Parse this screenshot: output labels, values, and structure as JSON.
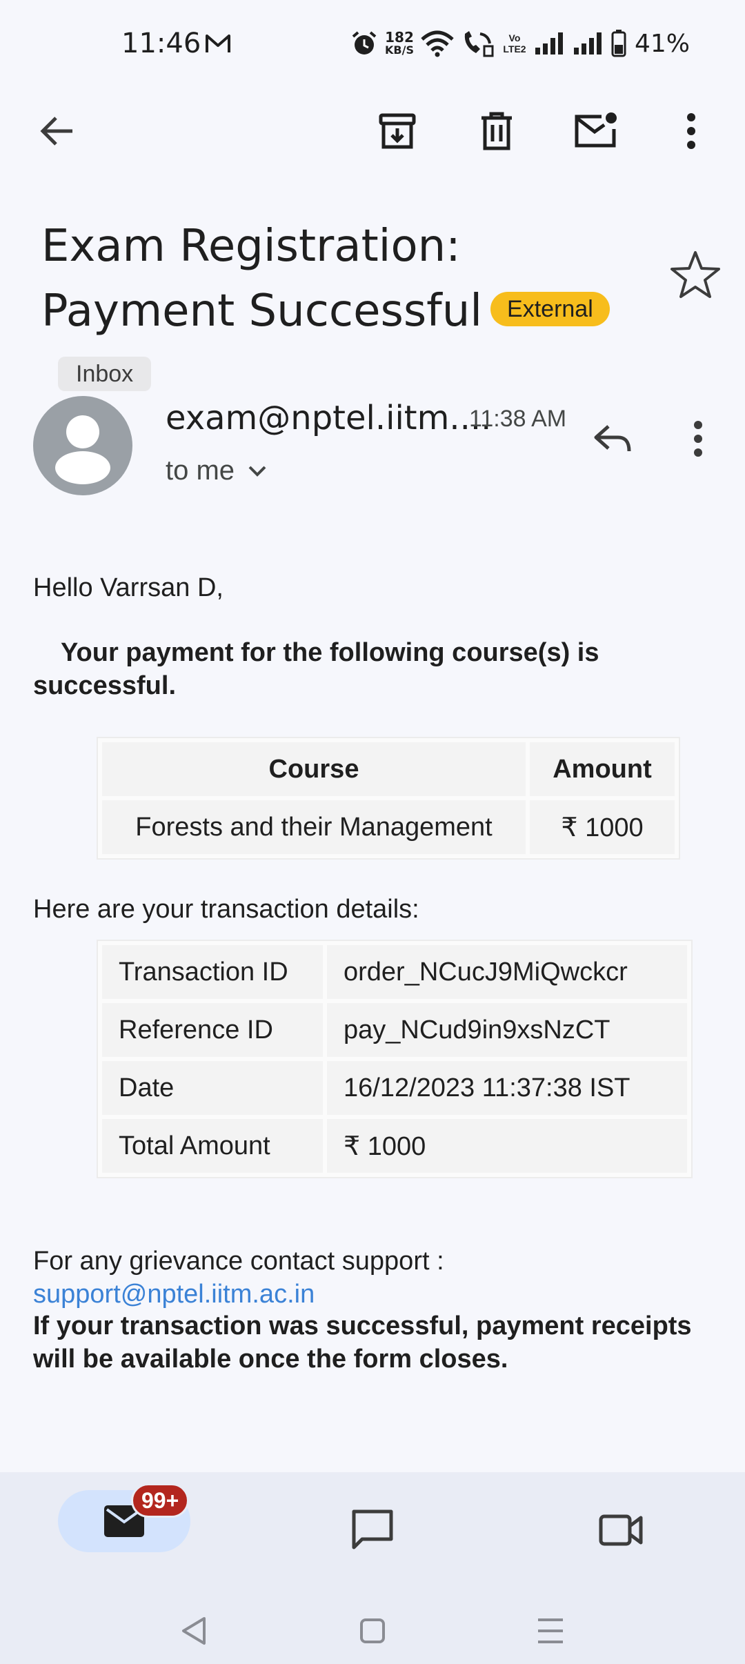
{
  "status_bar": {
    "time": "11:46",
    "speed_top": "182",
    "speed_bottom": "KB/S",
    "battery": "41%",
    "lte": "Vo LTE2"
  },
  "toolbar": {
    "back": "arrow-back-icon",
    "archive": "archive-icon",
    "delete": "delete-icon",
    "mark_unread": "mark-unread-icon",
    "more": "more-vert-icon"
  },
  "subject": {
    "text": "Exam Registration: Payment Successful",
    "label_external": "External",
    "label_inbox": "Inbox"
  },
  "sender": {
    "name": "exam@nptel.iitm....",
    "time": "11:38 AM",
    "to": "to me"
  },
  "email": {
    "greeting": "Hello Varrsan D,",
    "success_message": "Your payment for the following course(s) is successful.",
    "course_table": {
      "headers": [
        "Course",
        "Amount"
      ],
      "rows": [
        [
          "Forests and their Management",
          "₹ 1000"
        ]
      ]
    },
    "transaction_label": "Here are your transaction details:",
    "transaction_table": {
      "rows": [
        [
          "Transaction ID",
          "order_NCucJ9MiQwckcr"
        ],
        [
          "Reference ID",
          "pay_NCud9in9xsNzCT"
        ],
        [
          "Date",
          "16/12/2023 11:37:38 IST"
        ],
        [
          "Total Amount",
          "₹ 1000"
        ]
      ]
    },
    "grievance": "For any grievance contact support :",
    "support_email": "support@nptel.iitm.ac.in",
    "receipt_note": "If your transaction was successful, payment receipts will be available once the form closes."
  },
  "bottom_nav": {
    "mail_badge": "99+"
  },
  "colors": {
    "external_chip": "#f7bd1c",
    "link": "#3b82d6",
    "badge": "#b3261e",
    "active_pill": "#d3e3fd"
  }
}
